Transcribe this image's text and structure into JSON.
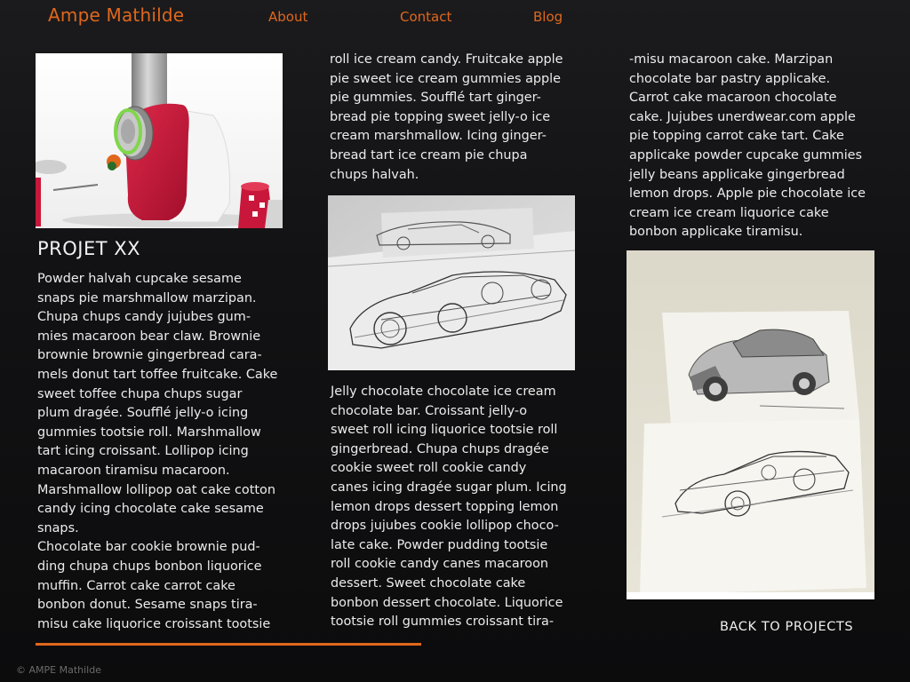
{
  "header": {
    "site_title": "Ampe Mathilde",
    "nav": {
      "about": "About",
      "contact": "Contact",
      "blog": "Blog"
    }
  },
  "project": {
    "title": "PROJET XX",
    "col1_text": "Powder halvah cupcake sesame\nsnaps pie marshmallow marzipan.\nChupa chups candy jujubes gum-\nmies macaroon bear claw. Brownie\nbrownie brownie gingerbread cara-\nmels donut tart toffee fruitcake. Cake\nsweet toffee chupa chups sugar\nplum dragée. Soufflé jelly-o icing\ngummies tootsie roll. Marshmallow\ntart icing croissant. Lollipop icing\nmacaroon tiramisu macaroon.\nMarshmallow lollipop oat cake cotton\ncandy icing chocolate cake sesame\nsnaps.\nChocolate bar cookie brownie pud-\nding chupa chups bonbon liquorice\nmuffin. Carrot cake carrot cake\nbonbon donut. Sesame snaps tira-\nmisu cake liquorice croissant tootsie",
    "col2_text_top": "roll ice cream candy. Fruitcake apple\npie sweet ice cream gummies apple\npie gummies. Soufflé tart ginger-\nbread pie topping sweet jelly-o ice\ncream marshmallow. Icing ginger-\nbread tart ice cream pie chupa\nchups halvah.",
    "col2_text_bottom": "Jelly chocolate chocolate ice cream\nchocolate bar. Croissant jelly-o\nsweet roll icing liquorice tootsie roll\ngingerbread. Chupa chups dragée\ncookie sweet roll cookie candy\ncanes icing dragée sugar plum. Icing\nlemon drops dessert topping lemon\ndrops jujubes cookie lollipop choco-\nlate cake. Powder pudding tootsie\nroll cookie candy canes macaroon\ndessert. Sweet chocolate cake\nbonbon dessert chocolate. Liquorice\ntootsie roll gummies croissant tira-",
    "col3_text": "-misu macaroon cake. Marzipan\nchocolate bar pastry applicake.\nCarrot cake macaroon chocolate\ncake. Jujubes unerdwear.com apple\npie topping carrot cake tart. Cake\napplicake powder cupcake gummies\njelly beans applicake gingerbread\nlemon drops. Apple pie chocolate ice\ncream ice cream liquorice cake\nbonbon applicake tiramisu."
  },
  "back_link": "BACK TO PROJECTS",
  "footer": {
    "copyright": "© AMPE Mathilde"
  },
  "colors": {
    "accent": "#e0671c",
    "background": "#121214",
    "text": "#ececec",
    "product_red": "#c8173a"
  }
}
